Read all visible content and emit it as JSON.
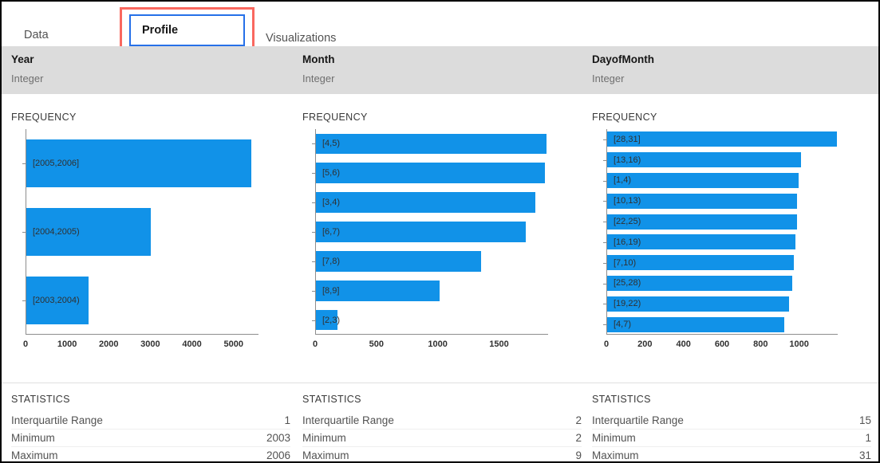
{
  "tabs": [
    {
      "label": "Data",
      "selected": false
    },
    {
      "label": "Profile",
      "selected": true
    },
    {
      "label": "Visualizations",
      "selected": false
    }
  ],
  "colors": {
    "bar": "#1192e8",
    "tab_focus_border": "#2670e8",
    "annotation": "#f9685f",
    "header_strip": "#dcdcdc"
  },
  "columns": [
    {
      "name": "Year",
      "type": "Integer",
      "frequency_label": "FREQUENCY",
      "statistics_label": "STATISTICS",
      "statistics": [
        {
          "name": "Interquartile Range",
          "value": "1"
        },
        {
          "name": "Minimum",
          "value": "2003"
        },
        {
          "name": "Maximum",
          "value": "2006"
        }
      ],
      "chart_data": {
        "type": "bar",
        "title": "FREQUENCY",
        "orientation": "horizontal",
        "xlabel": "",
        "ylabel": "",
        "grid": false,
        "legend": false,
        "xlim": [
          0,
          5600
        ],
        "xticks": [
          0,
          1000,
          2000,
          3000,
          4000,
          5000
        ],
        "categories": [
          "[2005,2006]",
          "[2004,2005)",
          "[2003,2004)"
        ],
        "values": [
          5400,
          3000,
          1500
        ]
      }
    },
    {
      "name": "Month",
      "type": "Integer",
      "frequency_label": "FREQUENCY",
      "statistics_label": "STATISTICS",
      "statistics": [
        {
          "name": "Interquartile Range",
          "value": "2"
        },
        {
          "name": "Minimum",
          "value": "2"
        },
        {
          "name": "Maximum",
          "value": "9"
        }
      ],
      "chart_data": {
        "type": "bar",
        "title": "FREQUENCY",
        "orientation": "horizontal",
        "xlabel": "",
        "ylabel": "",
        "grid": false,
        "legend": false,
        "xlim": [
          0,
          1900
        ],
        "xticks": [
          0,
          500,
          1000,
          1500
        ],
        "categories": [
          "[4,5)",
          "[5,6)",
          "[3,4)",
          "[6,7)",
          "[7,8)",
          "[8,9]",
          "[2,3)"
        ],
        "values": [
          1880,
          1870,
          1790,
          1710,
          1350,
          1010,
          175
        ]
      }
    },
    {
      "name": "DayofMonth",
      "type": "Integer",
      "frequency_label": "FREQUENCY",
      "statistics_label": "STATISTICS",
      "statistics": [
        {
          "name": "Interquartile Range",
          "value": "15"
        },
        {
          "name": "Minimum",
          "value": "1"
        },
        {
          "name": "Maximum",
          "value": "31"
        }
      ],
      "chart_data": {
        "type": "bar",
        "title": "FREQUENCY",
        "orientation": "horizontal",
        "xlabel": "",
        "ylabel": "",
        "grid": false,
        "legend": false,
        "xlim": [
          0,
          1200
        ],
        "xticks": [
          0,
          200,
          400,
          600,
          800,
          1000
        ],
        "categories": [
          "[28,31]",
          "[13,16)",
          "[1,4)",
          "[10,13)",
          "[22,25)",
          "[16,19)",
          "[7,10)",
          "[25,28)",
          "[19,22)",
          "[4,7)"
        ],
        "values": [
          1190,
          1005,
          995,
          985,
          985,
          975,
          970,
          960,
          945,
          920
        ]
      }
    }
  ]
}
